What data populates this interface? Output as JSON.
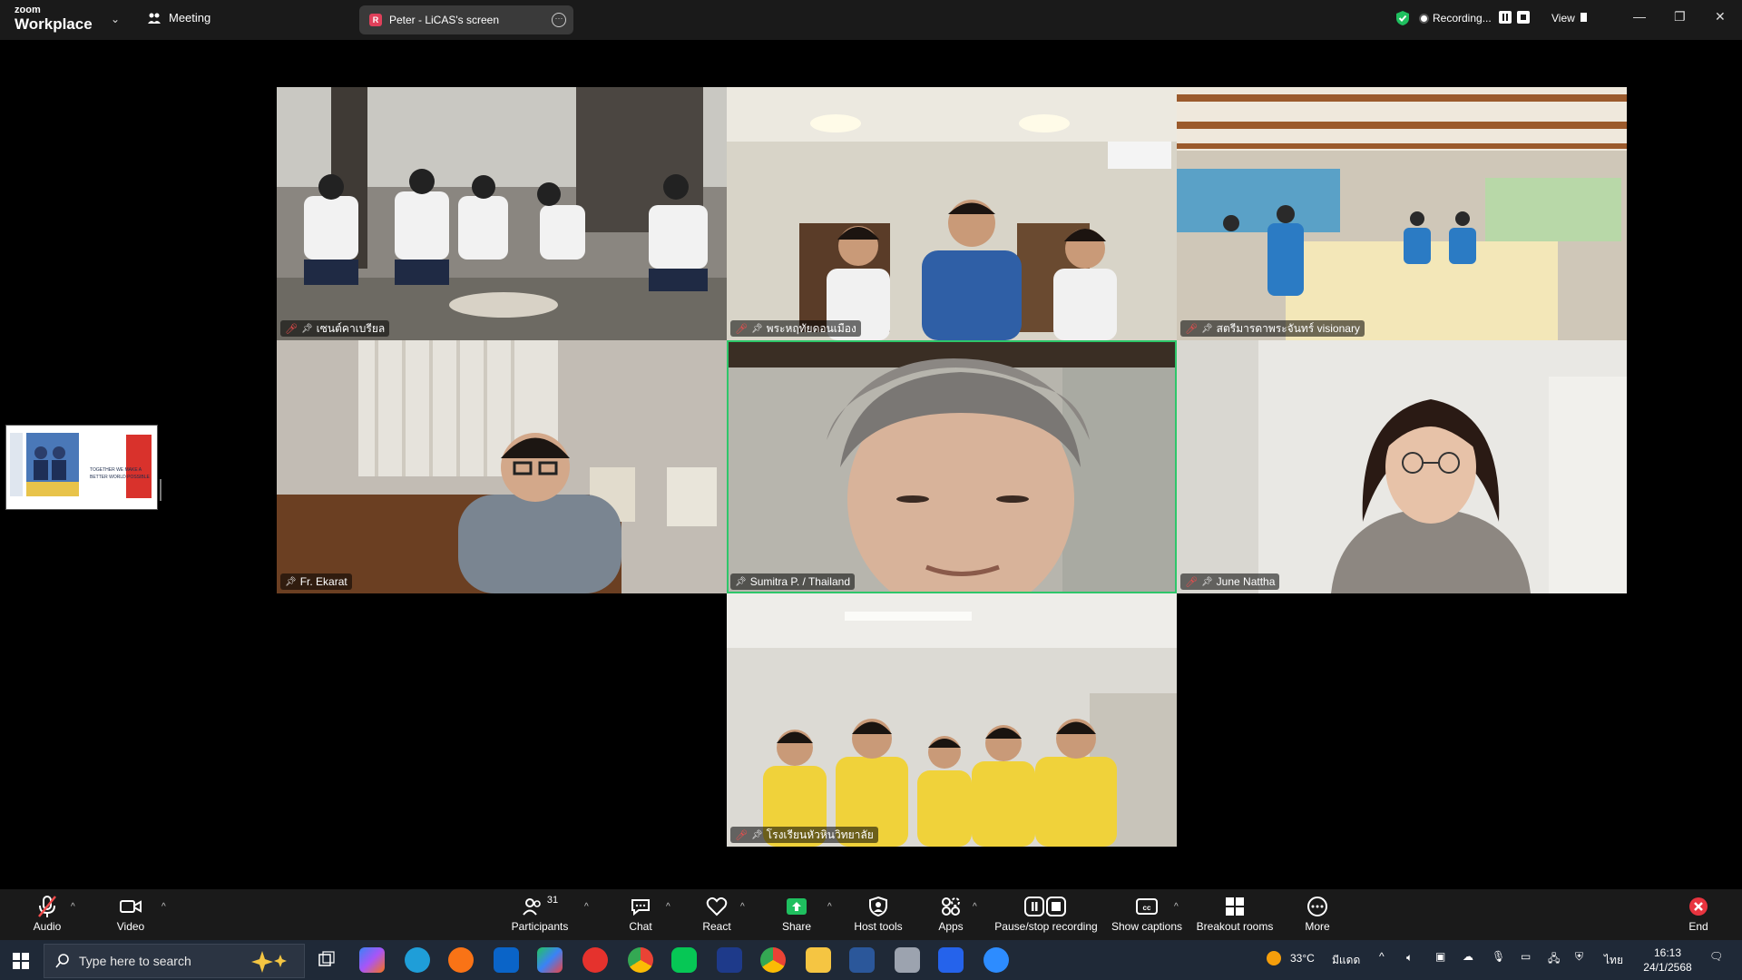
{
  "app": {
    "brand_small": "zoom",
    "brand_big": "Workplace",
    "meeting_label": "Meeting"
  },
  "share_pill": {
    "badge": "R",
    "label": "Peter - LiCAS's screen"
  },
  "recording": {
    "label": "Recording..."
  },
  "view": {
    "label": "View"
  },
  "tiles": [
    {
      "name": "เซนต์คาเบรียล",
      "muted": true,
      "pinned": true
    },
    {
      "name": "พระหฤทัยดอนเมือง",
      "muted": true,
      "pinned": true
    },
    {
      "name": "สตรีมารดาพระจันทร์ visionary",
      "muted": true,
      "pinned": true
    },
    {
      "name": "Fr. Ekarat",
      "muted": false,
      "pinned": true
    },
    {
      "name": "Sumitra P. / Thailand",
      "muted": false,
      "pinned": true,
      "active": true
    },
    {
      "name": "June Nattha",
      "muted": true,
      "pinned": true
    },
    {
      "name": "โรงเรียนหัวหินวิทยาลัย",
      "muted": true,
      "pinned": true
    }
  ],
  "thumbnail": {
    "line1": "TOGETHER WE MAKE A",
    "line2": "BETTER WORLD POSSIBLE"
  },
  "toolbar": {
    "audio": "Audio",
    "video": "Video",
    "participants": "Participants",
    "participants_count": "31",
    "chat": "Chat",
    "react": "React",
    "share": "Share",
    "host_tools": "Host tools",
    "apps": "Apps",
    "pause_stop": "Pause/stop recording",
    "captions": "Show captions",
    "breakout": "Breakout rooms",
    "more": "More",
    "end": "End"
  },
  "colors": {
    "accent_green": "#2ec66a",
    "mute_red": "#f24c4c",
    "share_green": "#1fbf5f",
    "end_red": "#e8343f"
  },
  "taskbar": {
    "search_placeholder": "Type here to search",
    "weather_temp": "33°C",
    "weather_label": "มีแดด",
    "lang": "ไทย",
    "time": "16:13",
    "date": "24/1/2568"
  }
}
